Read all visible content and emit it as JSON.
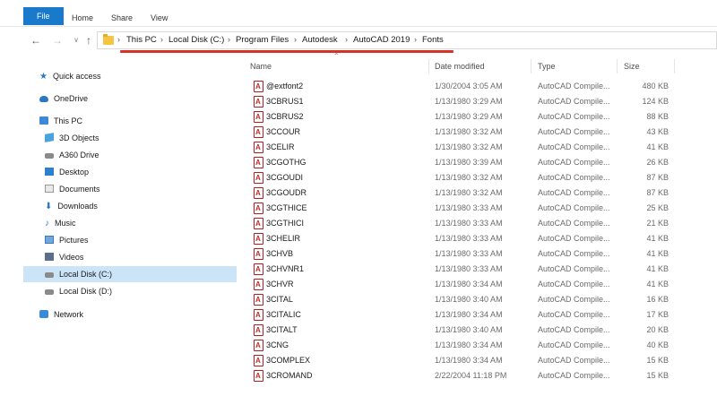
{
  "ribbon": {
    "tabs": [
      {
        "label": "File"
      },
      {
        "label": "Home"
      },
      {
        "label": "Share"
      },
      {
        "label": "View"
      }
    ]
  },
  "nav": {
    "back_icon": "arrow-left-icon",
    "forward_icon": "arrow-right-icon",
    "recent_icon": "chevron-down-icon",
    "up_icon": "arrow-up-icon"
  },
  "breadcrumb": [
    "This PC",
    "Local Disk (C:)",
    "Program Files",
    "Autodesk",
    "AutoCAD 2019",
    "Fonts"
  ],
  "colors": {
    "file_tab": "#1979ca",
    "selected_bg": "#cce4f7",
    "highlight": "#d93025",
    "file_icon": "#c62828"
  },
  "sidebar": {
    "items": [
      {
        "label": "Quick access",
        "icon": "star-icon",
        "selected": false
      },
      {
        "label": "OneDrive",
        "icon": "cloud-icon",
        "selected": false
      },
      {
        "label": "This PC",
        "icon": "computer-icon",
        "selected": false
      },
      {
        "label": "3D Objects",
        "icon": "cube-icon",
        "selected": false
      },
      {
        "label": "A360 Drive",
        "icon": "drive-icon",
        "selected": false
      },
      {
        "label": "Desktop",
        "icon": "desktop-icon",
        "selected": false
      },
      {
        "label": "Documents",
        "icon": "document-icon",
        "selected": false
      },
      {
        "label": "Downloads",
        "icon": "download-icon",
        "selected": false
      },
      {
        "label": "Music",
        "icon": "music-icon",
        "selected": false
      },
      {
        "label": "Pictures",
        "icon": "picture-icon",
        "selected": false
      },
      {
        "label": "Videos",
        "icon": "video-icon",
        "selected": false
      },
      {
        "label": "Local Disk (C:)",
        "icon": "disk-icon",
        "selected": true
      },
      {
        "label": "Local Disk (D:)",
        "icon": "disk-icon",
        "selected": false
      },
      {
        "label": "Network",
        "icon": "network-icon",
        "selected": false
      }
    ]
  },
  "columns": {
    "name": "Name",
    "date": "Date modified",
    "type": "Type",
    "size": "Size"
  },
  "files": [
    {
      "name": "@extfont2",
      "date": "1/30/2004 3:05 AM",
      "type": "AutoCAD Compile...",
      "size": "480 KB"
    },
    {
      "name": "3CBRUS1",
      "date": "1/13/1980 3:29 AM",
      "type": "AutoCAD Compile...",
      "size": "124 KB"
    },
    {
      "name": "3CBRUS2",
      "date": "1/13/1980 3:29 AM",
      "type": "AutoCAD Compile...",
      "size": "88 KB"
    },
    {
      "name": "3CCOUR",
      "date": "1/13/1980 3:32 AM",
      "type": "AutoCAD Compile...",
      "size": "43 KB"
    },
    {
      "name": "3CELIR",
      "date": "1/13/1980 3:32 AM",
      "type": "AutoCAD Compile...",
      "size": "41 KB"
    },
    {
      "name": "3CGOTHG",
      "date": "1/13/1980 3:39 AM",
      "type": "AutoCAD Compile...",
      "size": "26 KB"
    },
    {
      "name": "3CGOUDI",
      "date": "1/13/1980 3:32 AM",
      "type": "AutoCAD Compile...",
      "size": "87 KB"
    },
    {
      "name": "3CGOUDR",
      "date": "1/13/1980 3:32 AM",
      "type": "AutoCAD Compile...",
      "size": "87 KB"
    },
    {
      "name": "3CGTHICE",
      "date": "1/13/1980 3:33 AM",
      "type": "AutoCAD Compile...",
      "size": "25 KB"
    },
    {
      "name": "3CGTHICI",
      "date": "1/13/1980 3:33 AM",
      "type": "AutoCAD Compile...",
      "size": "21 KB"
    },
    {
      "name": "3CHELIR",
      "date": "1/13/1980 3:33 AM",
      "type": "AutoCAD Compile...",
      "size": "41 KB"
    },
    {
      "name": "3CHVB",
      "date": "1/13/1980 3:33 AM",
      "type": "AutoCAD Compile...",
      "size": "41 KB"
    },
    {
      "name": "3CHVNR1",
      "date": "1/13/1980 3:33 AM",
      "type": "AutoCAD Compile...",
      "size": "41 KB"
    },
    {
      "name": "3CHVR",
      "date": "1/13/1980 3:34 AM",
      "type": "AutoCAD Compile...",
      "size": "41 KB"
    },
    {
      "name": "3CITAL",
      "date": "1/13/1980 3:40 AM",
      "type": "AutoCAD Compile...",
      "size": "16 KB"
    },
    {
      "name": "3CITALIC",
      "date": "1/13/1980 3:34 AM",
      "type": "AutoCAD Compile...",
      "size": "17 KB"
    },
    {
      "name": "3CITALT",
      "date": "1/13/1980 3:40 AM",
      "type": "AutoCAD Compile...",
      "size": "20 KB"
    },
    {
      "name": "3CNG",
      "date": "1/13/1980 3:34 AM",
      "type": "AutoCAD Compile...",
      "size": "40 KB"
    },
    {
      "name": "3COMPLEX",
      "date": "1/13/1980 3:34 AM",
      "type": "AutoCAD Compile...",
      "size": "15 KB"
    },
    {
      "name": "3CROMAND",
      "date": "2/22/2004 11:18 PM",
      "type": "AutoCAD Compile...",
      "size": "15 KB"
    }
  ]
}
